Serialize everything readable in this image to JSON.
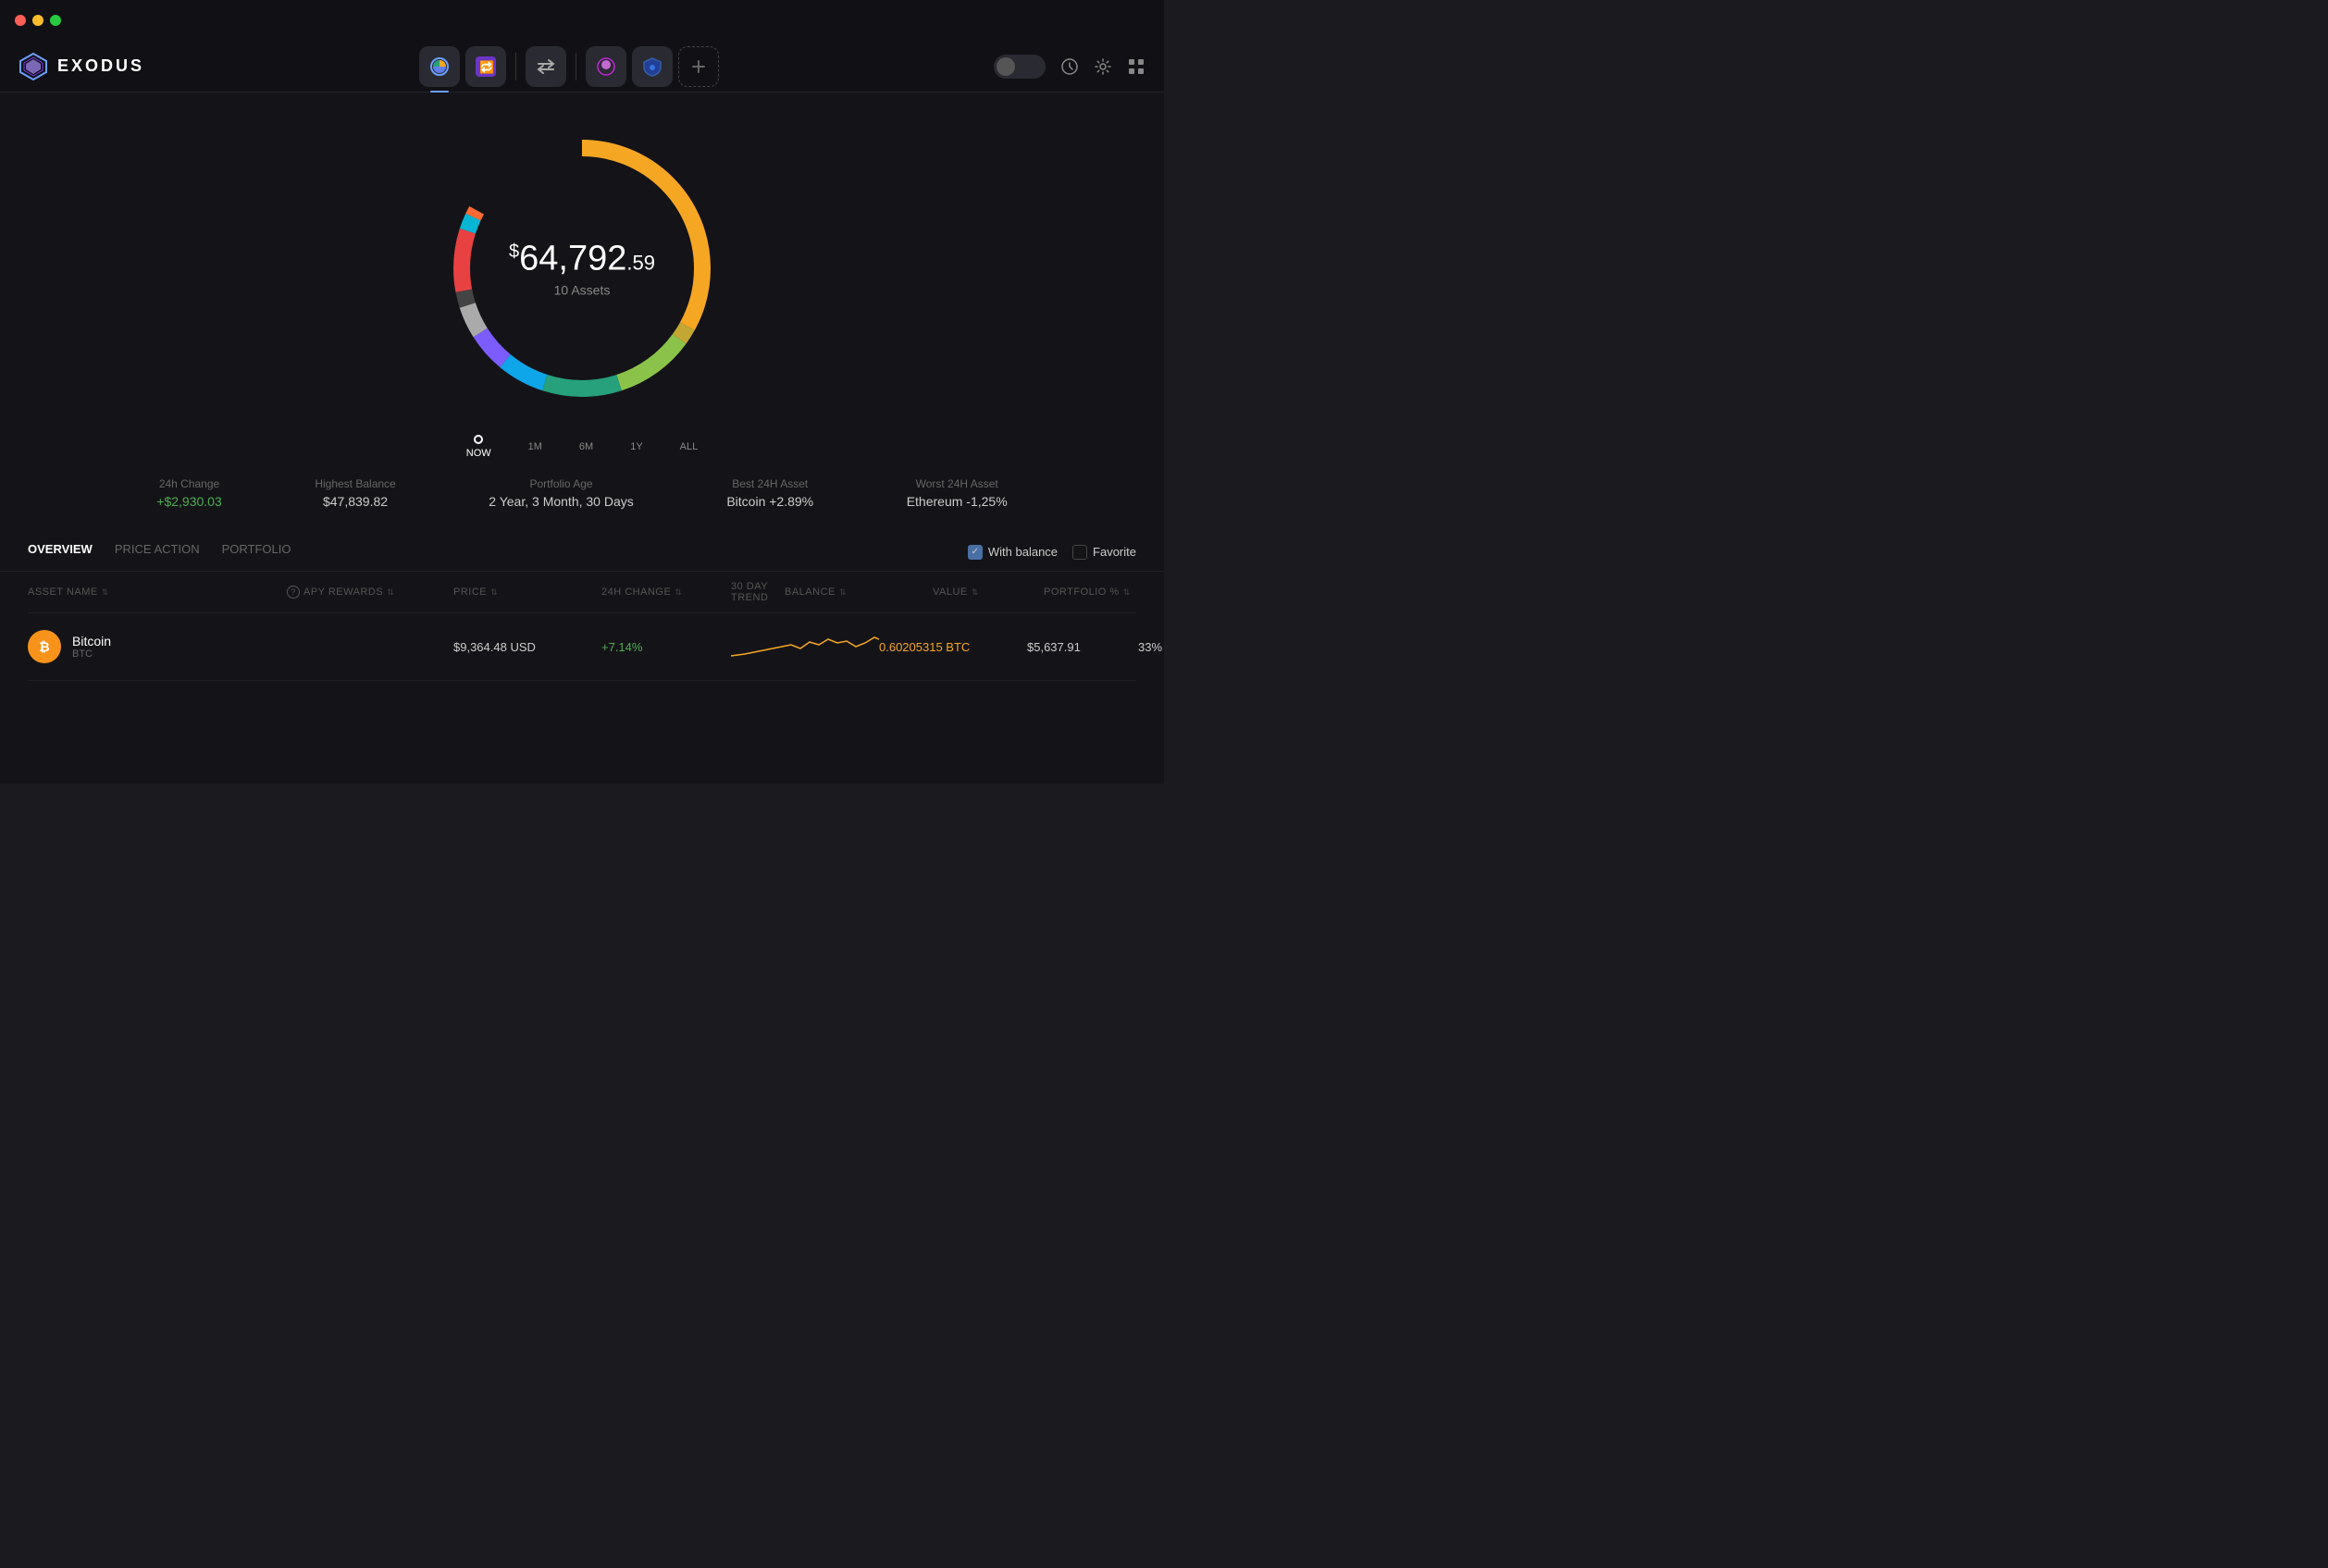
{
  "titlebar": {
    "dots": [
      "red",
      "yellow",
      "green"
    ]
  },
  "navbar": {
    "logo_text": "EXODUS",
    "nav_items": [
      {
        "id": "portfolio",
        "active": true
      },
      {
        "id": "exchange",
        "active": false
      },
      {
        "id": "nft",
        "active": false
      },
      {
        "id": "web3",
        "active": false
      },
      {
        "id": "shield",
        "active": false
      },
      {
        "id": "add",
        "active": false
      }
    ]
  },
  "portfolio": {
    "total_amount_prefix": "$",
    "total_amount_main": "64,792",
    "total_amount_cents": ".59",
    "assets_count": "10 Assets"
  },
  "timeline": {
    "points": [
      "NOW",
      "1M",
      "6M",
      "1Y",
      "ALL"
    ]
  },
  "stats": [
    {
      "label": "24h Change",
      "value": "+$2,930.03",
      "positive": true
    },
    {
      "label": "Highest Balance",
      "value": "$47,839.82",
      "positive": false
    },
    {
      "label": "Portfolio Age",
      "value": "2 Year, 3 Month, 30 Days",
      "positive": false
    },
    {
      "label": "Best 24H Asset",
      "value": "Bitcoin +2.89%",
      "positive": false
    },
    {
      "label": "Worst 24H Asset",
      "value": "Ethereum -1,25%",
      "positive": false
    }
  ],
  "tabs": {
    "items": [
      "OVERVIEW",
      "PRICE ACTION",
      "PORTFOLIO"
    ],
    "active": 0
  },
  "filters": {
    "with_balance": "With balance",
    "with_balance_checked": true,
    "favorite": "Favorite",
    "favorite_checked": false
  },
  "table": {
    "headers": [
      {
        "label": "ASSET NAME",
        "sortable": true
      },
      {
        "label": "APY REWARDS",
        "sortable": true,
        "has_info": true
      },
      {
        "label": "PRICE",
        "sortable": true
      },
      {
        "label": "24H CHANGE",
        "sortable": true
      },
      {
        "label": "30 DAY TREND",
        "sortable": false
      },
      {
        "label": "BALANCE",
        "sortable": true
      },
      {
        "label": "VALUE",
        "sortable": true
      },
      {
        "label": "PORTFOLIO %",
        "sortable": true
      }
    ],
    "rows": [
      {
        "name": "Bitcoin",
        "ticker": "BTC",
        "icon_bg": "#f7931a",
        "icon_text": "₿",
        "apy": "",
        "price": "$9,364.48 USD",
        "change": "+7.14%",
        "change_positive": true,
        "balance": "0.60205315 BTC",
        "balance_color": "orange",
        "value": "$5,637.91",
        "portfolio": "33%"
      }
    ]
  },
  "donut_segments": [
    {
      "color": "#f5a623",
      "pct": 33
    },
    {
      "color": "#627eea",
      "pct": 18
    },
    {
      "color": "#26a17b",
      "pct": 12
    },
    {
      "color": "#e84142",
      "pct": 8
    },
    {
      "color": "#00d395",
      "pct": 10
    },
    {
      "color": "#2775ca",
      "pct": 6
    },
    {
      "color": "#8247e5",
      "pct": 5
    },
    {
      "color": "#aaa",
      "pct": 4
    },
    {
      "color": "#6fceb7",
      "pct": 2
    },
    {
      "color": "#c3a634",
      "pct": 2
    }
  ]
}
